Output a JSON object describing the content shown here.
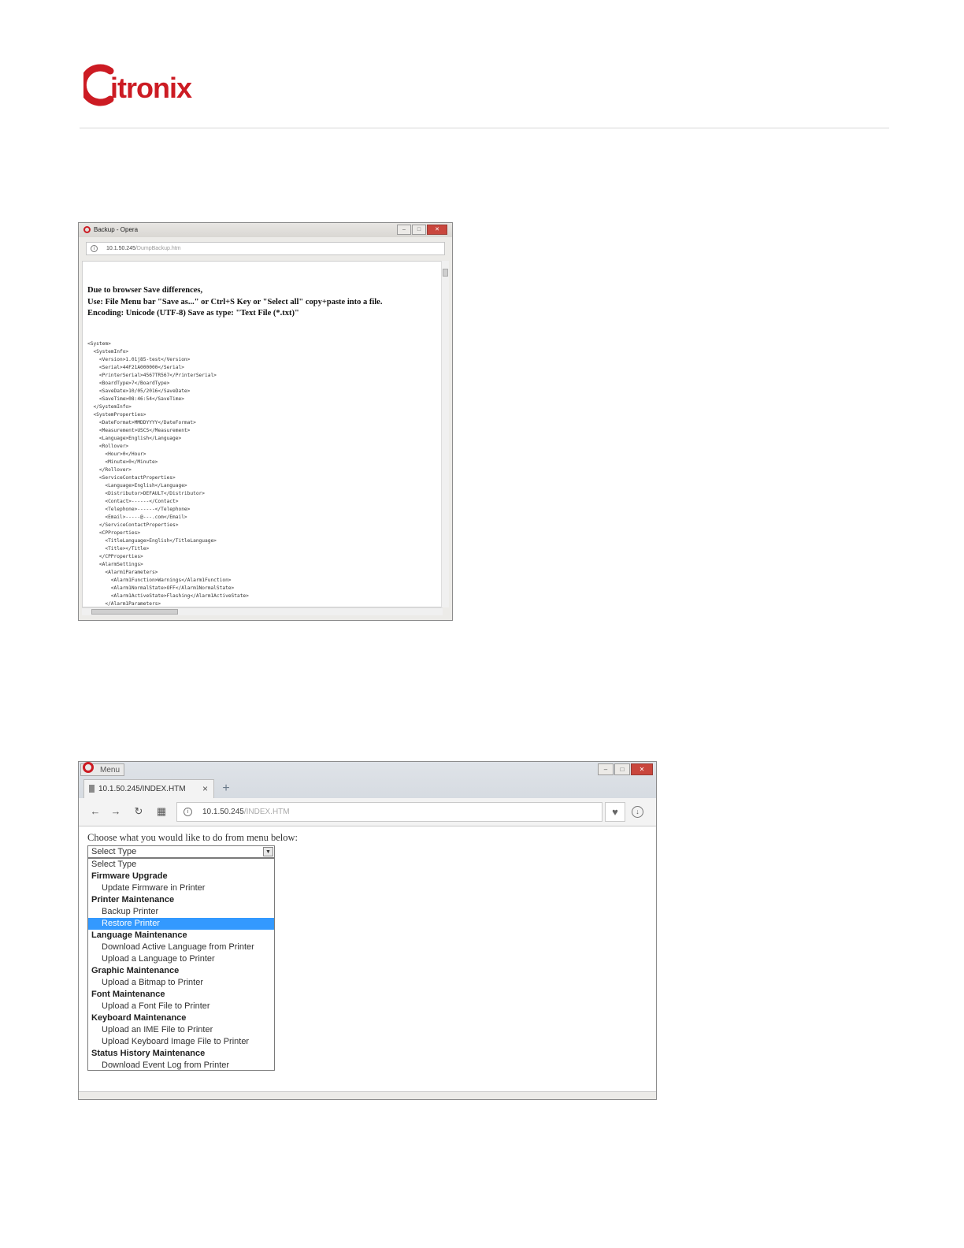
{
  "brand": {
    "logo_text": "Citronix",
    "accent_color": "#cc1b23"
  },
  "screenshot1": {
    "window_title": "Backup - Opera",
    "address": {
      "host": "10.1.50.245",
      "path": "/DumpBackup.htm"
    },
    "notice_lines": [
      "Due to browser Save differences,",
      "Use: File Menu bar \"Save as...\" or Ctrl+S Key or \"Select all\" copy+paste into a file.",
      "Encoding: Unicode (UTF-8) Save as type: \"Text File (*.txt)\""
    ],
    "xml_lines": [
      "<System>",
      "  <SystemInfo>",
      "    <Version>1.01j85-test</Version>",
      "    <Serial>44F21A000000</Serial>",
      "    <PrinterSerial>4567TR567</PrinterSerial>",
      "    <BoardType>7</BoardType>",
      "    <SaveDate>10/05/2016</SaveDate>",
      "    <SaveTime>08:46:54</SaveTime>",
      "  </SystemInfo>",
      "  <SystemProperties>",
      "    <DateFormat>MMDDYYYY</DateFormat>",
      "    <Measurement>USCS</Measurement>",
      "    <Language>English</Language>",
      "    <Rollover>",
      "      <Hour>0</Hour>",
      "      <Minute>0</Minute>",
      "    </Rollover>",
      "    <ServiceContactProperties>",
      "      <Language>English</Language>",
      "      <Distributor>DEFAULT</Distributor>",
      "      <Contact>------</Contact>",
      "      <Telephone>------</Telephone>",
      "      <Email>-----@---.com</Email>",
      "    </ServiceContactProperties>",
      "    <CPProperties>",
      "      <TitleLanguage>English</TitleLanguage>",
      "      <Title></Title>",
      "    </CPProperties>",
      "    <AlarmSettings>",
      "      <Alarm1Parameters>",
      "        <Alarm1Function>Warnings</Alarm1Function>",
      "        <Alarm1NormalState>OFF</Alarm1NormalState>",
      "        <Alarm1ActiveState>Flashing</Alarm1ActiveState>",
      "      </Alarm1Parameters>"
    ]
  },
  "screenshot2": {
    "menu_label": "Menu",
    "tab_title": "10.1.50.245/INDEX.HTM",
    "address": {
      "host": "10.1.50.245",
      "path": "/INDEX.HTM"
    },
    "prompt": "Choose what you would like to do from menu below:",
    "select_value": "Select Type",
    "options": [
      {
        "label": "Select Type",
        "kind": "plain"
      },
      {
        "label": "Firmware Upgrade",
        "kind": "group"
      },
      {
        "label": "Update Firmware in Printer",
        "kind": "child"
      },
      {
        "label": "Printer Maintenance",
        "kind": "group"
      },
      {
        "label": "Backup Printer",
        "kind": "child"
      },
      {
        "label": "Restore Printer",
        "kind": "child",
        "selected": true
      },
      {
        "label": "Language Maintenance",
        "kind": "group"
      },
      {
        "label": "Download Active Language from Printer",
        "kind": "child"
      },
      {
        "label": "Upload a Language to Printer",
        "kind": "child"
      },
      {
        "label": "Graphic Maintenance",
        "kind": "group"
      },
      {
        "label": "Upload a Bitmap to Printer",
        "kind": "child"
      },
      {
        "label": "Font Maintenance",
        "kind": "group"
      },
      {
        "label": "Upload a Font File to Printer",
        "kind": "child"
      },
      {
        "label": "Keyboard Maintenance",
        "kind": "group"
      },
      {
        "label": "Upload an IME File to Printer",
        "kind": "child"
      },
      {
        "label": "Upload Keyboard Image File to Printer",
        "kind": "child"
      },
      {
        "label": "Status History Maintenance",
        "kind": "group"
      },
      {
        "label": "Download Event Log from Printer",
        "kind": "child"
      }
    ],
    "selection_color": "#3399ff"
  }
}
